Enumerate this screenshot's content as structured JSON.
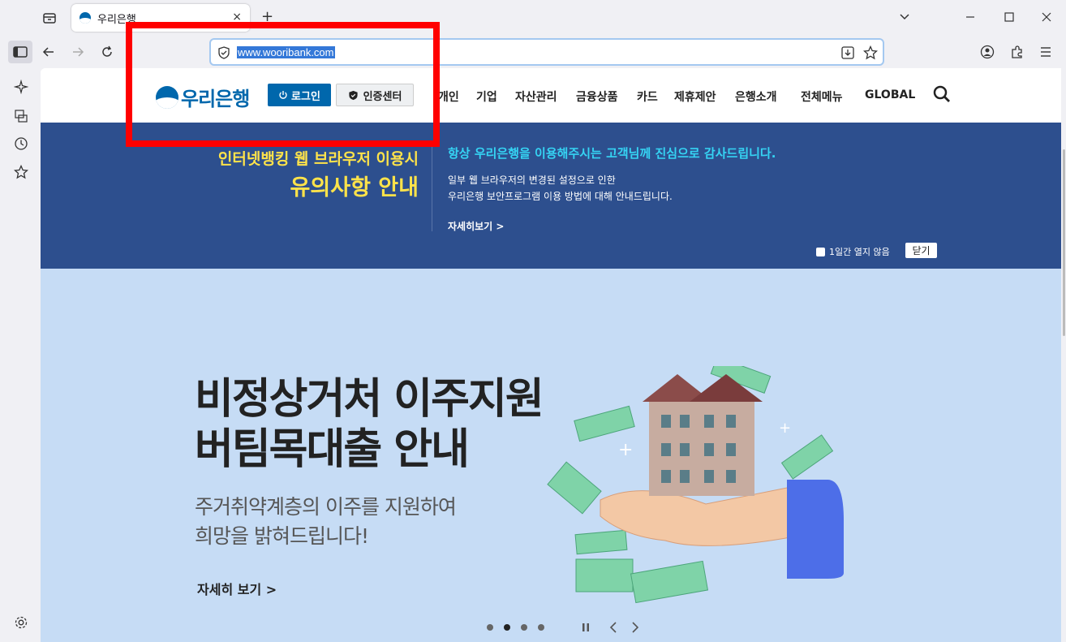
{
  "browser": {
    "tab_title": "우리은행",
    "tab_close": "×",
    "new_tab": "+",
    "url": "www.wooribank.com"
  },
  "header": {
    "logo_text": "우리은행",
    "login_label": "로그인",
    "cert_label": "인증센터",
    "nav": [
      "개인",
      "기업",
      "자산관리",
      "금융상품",
      "카드",
      "제휴제안",
      "은행소개",
      "전체메뉴",
      "GLOBAL"
    ]
  },
  "notice": {
    "title_line1": "인터넷뱅킹 웹 브라우저 이용시",
    "title_line2": "유의사항 안내",
    "headline": "항상 우리은행을 이용해주시는 고객님께 진심으로 감사드립니다.",
    "body_line1": "일부 웹 브라우저의 변경된 설정으로 인한",
    "body_line2": "우리은행 보안프로그램 이용 방법에 대해 안내드립니다.",
    "more": "자세히보기 >",
    "dismiss_label": "1일간 열지 않음",
    "close_label": "닫기"
  },
  "hero": {
    "title_line1": "비정상거처 이주지원",
    "title_line2": "버팀목대출 안내",
    "sub_line1": "주거취약계층의 이주를 지원하여",
    "sub_line2": "희망을 밝혀드립니다!",
    "more": "자세히 보기 >",
    "slide_count": 4,
    "active_slide": 2
  },
  "colors": {
    "brand": "#0067ac",
    "notice_bg": "#2d4f8e",
    "notice_accent": "#ffe34a",
    "notice_headline": "#35d4f4",
    "hero_bg": "#c6dcf5",
    "highlight_box": "#ff0000"
  }
}
